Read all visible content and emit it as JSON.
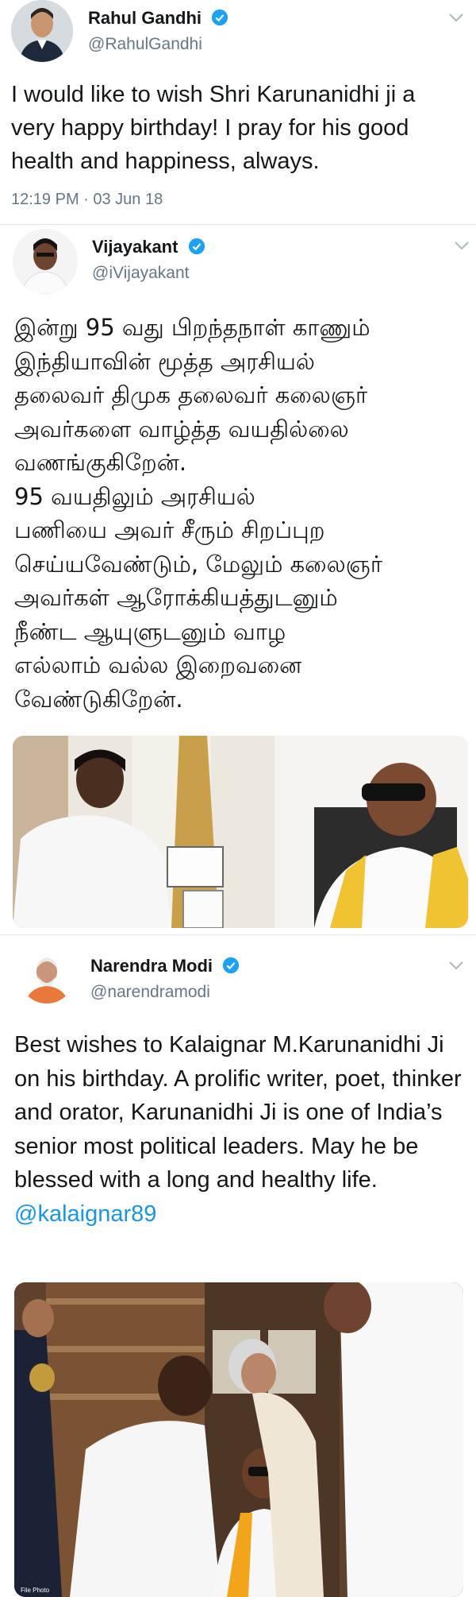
{
  "tweets": [
    {
      "name": "Rahul Gandhi",
      "handle": "@RahulGandhi",
      "text": "I would like to wish Shri Karunanidhi ji a very happy birthday! I pray for his good health and happiness, always.",
      "time": "12:19 PM · 03 Jun 18"
    },
    {
      "name": "Vijayakant",
      "handle": "@iVijayakant",
      "text_lines": [
        "இன்று 95 வது பிறந்தநாள் காணும்",
        "இந்தியாவின் மூத்த அரசியல்",
        "தலைவர் திமுக தலைவர் கலைஞர்",
        "அவர்களை வாழ்த்த வயதில்லை",
        "வணங்குகிறேன்.",
        "95 வயதிலும் அரசியல்",
        "பணியை அவர் சீரும் சிறப்புற",
        "செய்யவேண்டும், மேலும் கலைஞர்",
        "அவர்கள் ஆரோக்கியத்துடனும்",
        "நீண்ட ஆயுளுடனும் வாழ",
        "எல்லாம் வல்ல இறைவனை",
        "வேண்டுகிறேன்."
      ]
    },
    {
      "name": "Narendra Modi",
      "handle": "@narendramodi",
      "text": "Best wishes to Kalaignar M.Karunanidhi Ji on his birthday. A prolific writer, poet, thinker and orator, Karunanidhi Ji is one of India’s senior most political leaders. May he be blessed with a long and healthy life.",
      "mention": "@kalaignar89",
      "photo_label": "File Photo"
    }
  ],
  "colors": {
    "verified": "#1da1f2",
    "link": "#1b95e0",
    "secondary": "#657786"
  },
  "icons": [
    "verified-badge-icon",
    "chevron-down-icon"
  ]
}
